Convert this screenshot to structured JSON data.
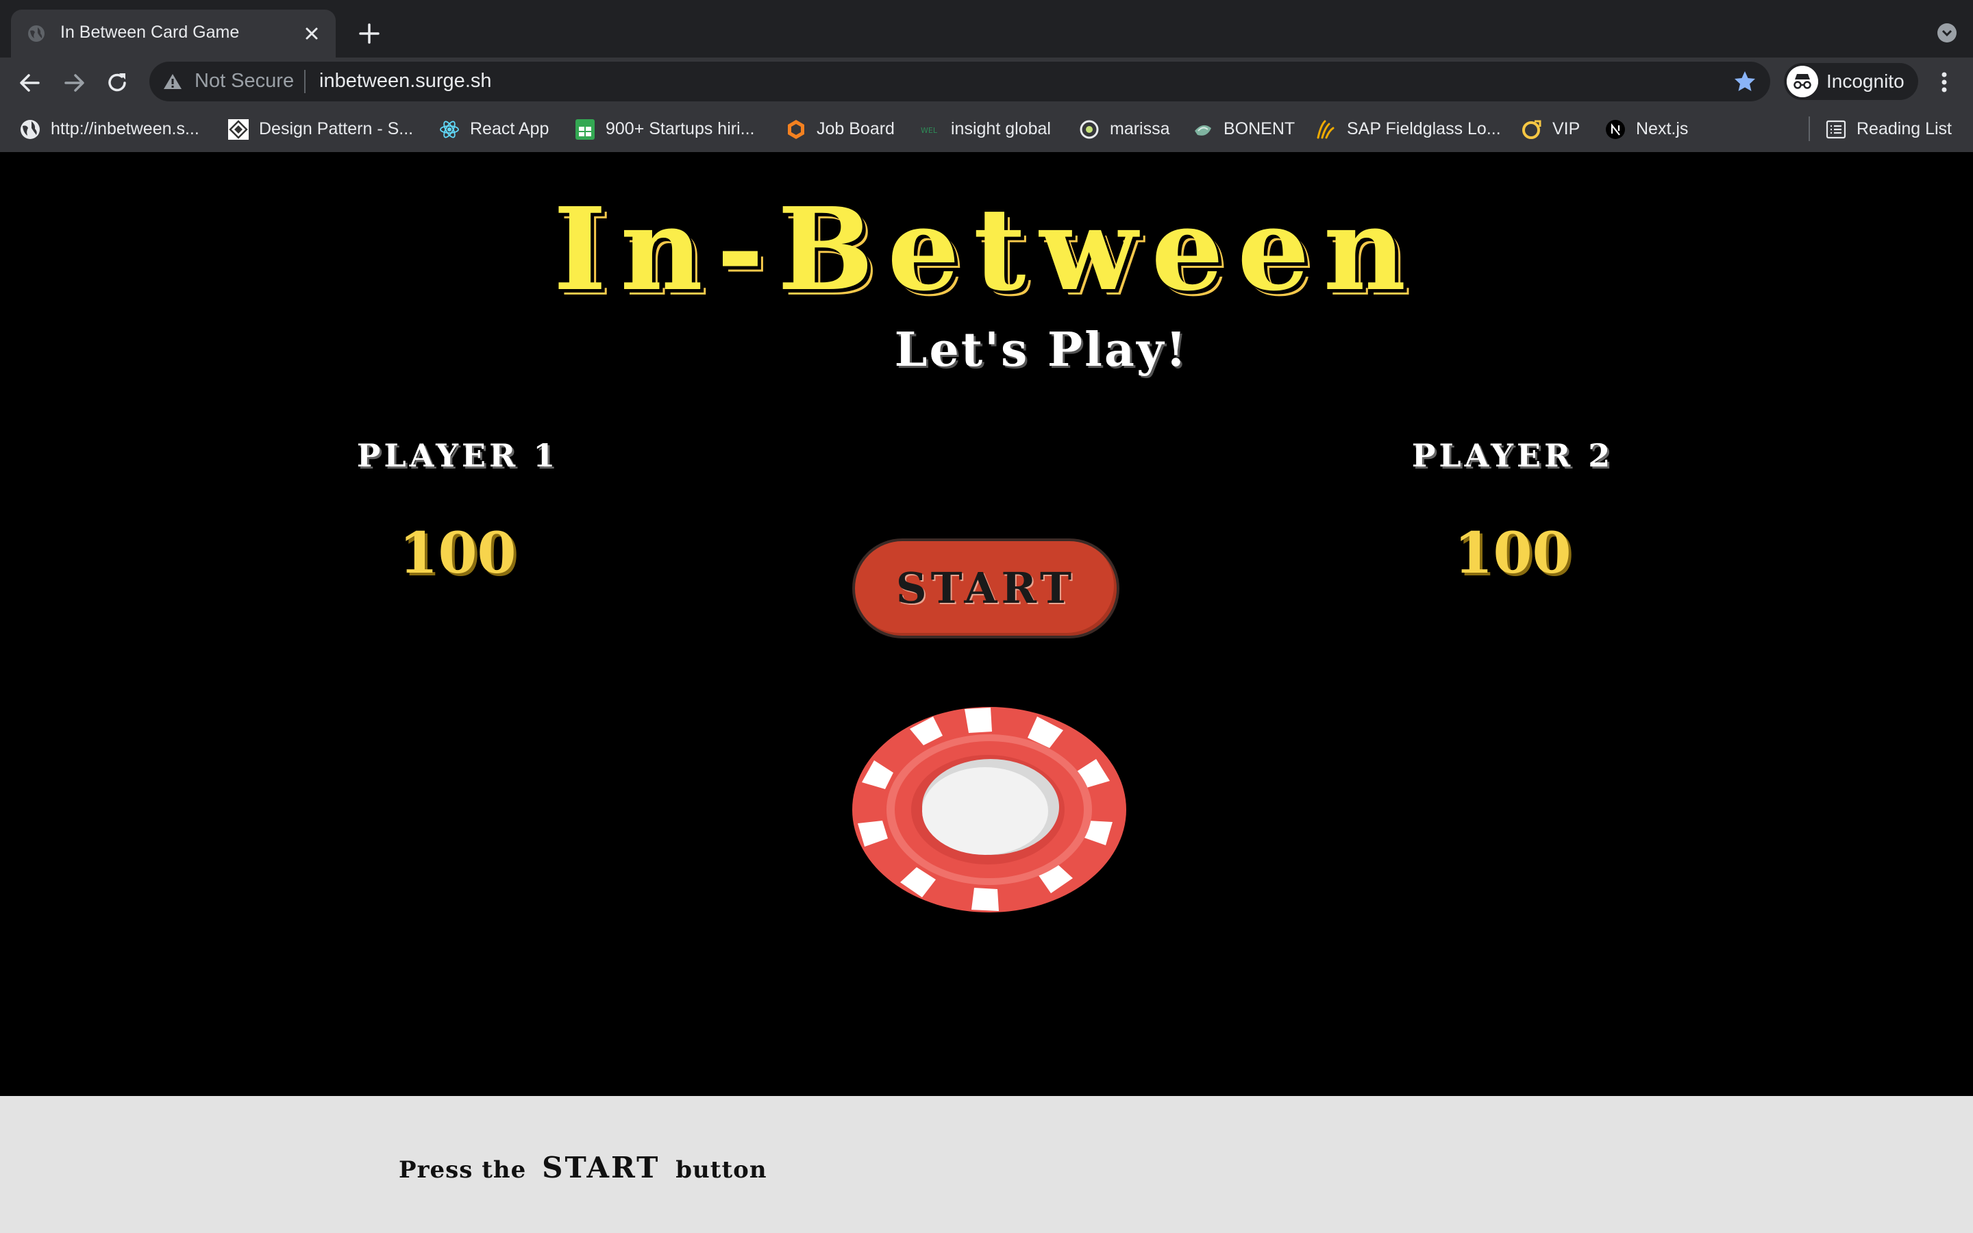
{
  "browser": {
    "tab": {
      "title": "In Between Card Game"
    },
    "omnibox": {
      "security": "Not Secure",
      "url": "inbetween.surge.sh"
    },
    "profile": {
      "label": "Incognito"
    },
    "bookmarks": [
      {
        "label": "http://inbetween.s...",
        "icon": "globe-icon"
      },
      {
        "label": "Design Pattern - S...",
        "icon": "design-pattern-icon"
      },
      {
        "label": "React App",
        "icon": "react-icon"
      },
      {
        "label": "900+ Startups hiri...",
        "icon": "sheets-icon"
      },
      {
        "label": "Job Board",
        "icon": "job-board-icon"
      },
      {
        "label": "insight global",
        "icon": "insight-global-icon"
      },
      {
        "label": "marissa",
        "icon": "marissa-icon"
      },
      {
        "label": "BONENT",
        "icon": "bonent-icon"
      },
      {
        "label": "SAP Fieldglass Lo...",
        "icon": "sap-fieldglass-icon"
      },
      {
        "label": "VIP",
        "icon": "vip-icon"
      },
      {
        "label": "Next.js",
        "icon": "nextjs-icon"
      }
    ],
    "reading_list": "Reading List"
  },
  "game": {
    "title": "In-Between",
    "subtitle": "Let's Play!",
    "players": [
      {
        "label": "PLAYER 1",
        "score": "100"
      },
      {
        "label": "PLAYER 2",
        "score": "100"
      }
    ],
    "start_button": "START",
    "chip_icon": "poker-chip-icon"
  },
  "footer": {
    "prefix": "Press the",
    "emphasis": "START",
    "suffix": "button"
  },
  "colors": {
    "title_yellow": "#fbed4a",
    "score_gold": "#f7d44c",
    "start_red": "#c9402a",
    "chip_red": "#e8514a",
    "footer_bg": "#e3e3e3"
  }
}
